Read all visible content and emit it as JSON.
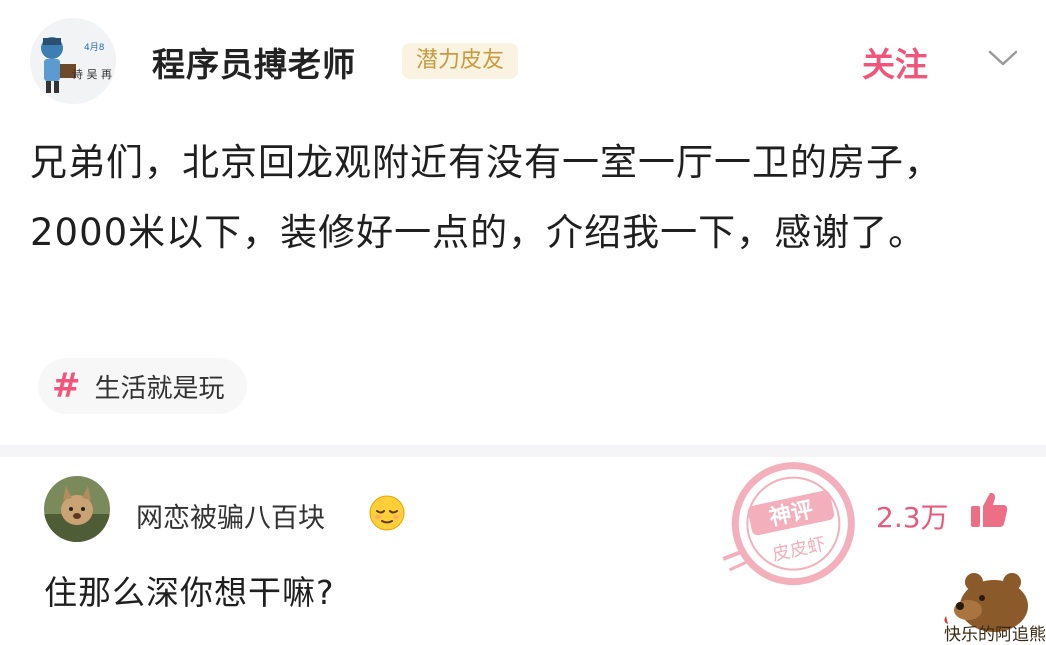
{
  "post": {
    "author": "程序员搏老师",
    "badge": "潜力皮友",
    "follow_label": "关注",
    "text": "兄弟们，北京回龙观附近有没有一室一厅一卫的房子，2000米以下，装修好一点的，介绍我一下，感谢了。",
    "topic_hash": "#",
    "topic": "生活就是玩",
    "avatar_text": "诗 吴 再"
  },
  "comment": {
    "author": "网恋被骗八百块",
    "text": "住那么深你想干嘛?",
    "likes": "2.3万",
    "stamp_line1": "神评",
    "stamp_line2": "皮皮虾"
  },
  "watermark": {
    "text": "快乐的阿追熊"
  },
  "colors": {
    "accent": "#f0557b",
    "badge_text": "#c99a3e",
    "badge_bg": "#fbf3e2",
    "like": "#e75a7c"
  },
  "icons": {
    "expand": "chevron-down-icon",
    "topic": "hashtag-icon",
    "like": "thumbs-up-icon",
    "emoji": "relieved-face-icon",
    "stamp": "god-comment-stamp-icon"
  }
}
